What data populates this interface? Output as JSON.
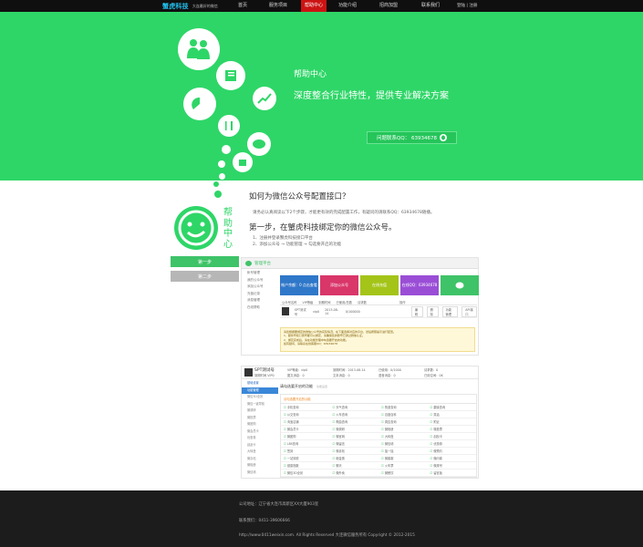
{
  "brand": {
    "logo_text": "蟹虎科技",
    "tagline": "大连最好的微信"
  },
  "nav": {
    "items": [
      {
        "label": "首页",
        "active": false
      },
      {
        "label": "服务项目",
        "active": false
      },
      {
        "label": "帮助中心",
        "active": true
      },
      {
        "label": "功能介绍",
        "active": false
      },
      {
        "label": "招商加盟",
        "active": false
      },
      {
        "label": "联系我们",
        "active": false
      }
    ],
    "login_label": "登陆",
    "register_label": "注册"
  },
  "hero": {
    "title": "帮助中心",
    "subtitle": "深度整合行业特性，提供专业解决方案",
    "qq_button": "问题联系QQ：  63934678",
    "bg_color": "#2ed667"
  },
  "help": {
    "vertical_label": "帮助中心",
    "heading": "如何为微信公众号配置接口？",
    "intro": "请务必认真阅读以下2个步骤，才能更有效的完成配置工作，有疑问的请联系QQ：63934678随播。",
    "step_heading": "第一步，在蟹虎科技绑定你的微信公众号。",
    "steps": [
      "1、注册并登录蟹虎科技接口平台",
      "2、添加公众号 → 功能管理 → 勾选要开启的功能"
    ]
  },
  "tabs": {
    "step1": "第一步",
    "step2": "第二步"
  },
  "mock1": {
    "platform_title": "管理平台",
    "sidebar": [
      "帐号管理",
      "我的公众号",
      "添加公众号",
      "充值记录",
      "消息管理",
      "在线帮助"
    ],
    "tiles": [
      {
        "label": "帐户余额：0  点击查看",
        "color": "#2f77c9"
      },
      {
        "label": "添加公众号",
        "color": "#d9366a"
      },
      {
        "label": "在线充值",
        "color": "#a4c419"
      },
      {
        "label": "在线QQ：63934678",
        "color": "#9a4ed6"
      },
      {
        "label": "",
        "color": "#3ec368"
      }
    ],
    "table_head": [
      "公众号名称",
      "VIP等级",
      "到期时间",
      "已使用/总数",
      "请求数",
      "操作"
    ],
    "row": {
      "name": "SPT测试号",
      "vip": "vip0",
      "date": "2013-08-14",
      "count": "0/100000",
      "actions": [
        "编辑",
        "删除",
        "功能管理",
        "API接口"
      ]
    },
    "notice": [
      "请您根据要绑定的微信公众号的实际情况，在下面选择对应的平台，然后按照提示进行配置。",
      "1、服务号和订阅号都可以绑定，请确保您的账号已通过微信认证。",
      "2、绑定完成后，请在功能管理中勾选要开启的功能。",
      "如有疑问，请联系在线客服QQ：63934678"
    ]
  },
  "mock2": {
    "account_name": "SPT测试号",
    "account_sub": "到期时间 VIP0",
    "info": [
      "VIP等级：vip0",
      "到期时间：2013-08-14",
      "已使用：0/1000",
      "请求数：0",
      "图文消息：0",
      "文本消息：0",
      "语音消息：0",
      "已用空间：0K"
    ],
    "sidebar": [
      {
        "label": "基础设置",
        "kind": "head"
      },
      {
        "label": "功能管理",
        "kind": "sel"
      },
      {
        "label": "微信3D全景",
        "kind": "normal"
      },
      {
        "label": "微信一键导航",
        "kind": "normal"
      },
      {
        "label": "微调研",
        "kind": "normal"
      },
      {
        "label": "微投票",
        "kind": "normal"
      },
      {
        "label": "微团购",
        "kind": "normal"
      },
      {
        "label": "微会员卡",
        "kind": "normal"
      },
      {
        "label": "优惠券",
        "kind": "normal"
      },
      {
        "label": "刮刮卡",
        "kind": "normal"
      },
      {
        "label": "大转盘",
        "kind": "normal"
      },
      {
        "label": "微喜帖",
        "kind": "normal"
      },
      {
        "label": "微相册",
        "kind": "normal"
      },
      {
        "label": "微信墙",
        "kind": "normal"
      }
    ],
    "main_title": "请勾选要开启的功能",
    "main_sub": "功能设置",
    "grid_head": "请勾选要开启的功能",
    "features": [
      "手机查询",
      "天气查询",
      "快递查询",
      "翻译查询",
      "公交查询",
      "火车查询",
      "百度百科",
      "笑话",
      "淘宝店铺",
      "歌曲查询",
      "周边查询",
      "附近",
      "微会员卡",
      "微调研",
      "微相册",
      "微投票",
      "微团购",
      "微官网",
      "大转盘",
      "刮刮卡",
      "LBS查询",
      "微留言",
      "微信墙",
      "优惠券",
      "签到",
      "微喜帖",
      "摇一摇",
      "微预约",
      "一站到底",
      "砸金蛋",
      "微客服",
      "微问卷",
      "健康指数",
      "聊天",
      "火车票",
      "微排号",
      "微信3D全景",
      "微外卖",
      "微餐饮",
      "留言板"
    ]
  },
  "footer": {
    "address": "公司地址：辽宁省大连市高新区XX大厦903室",
    "phone": "联系我们：0411-39606666",
    "copyright": "http://www.0411weixin.com. All Rights Reserved 大连微信服务所有 Copyright © 2012-2015"
  }
}
